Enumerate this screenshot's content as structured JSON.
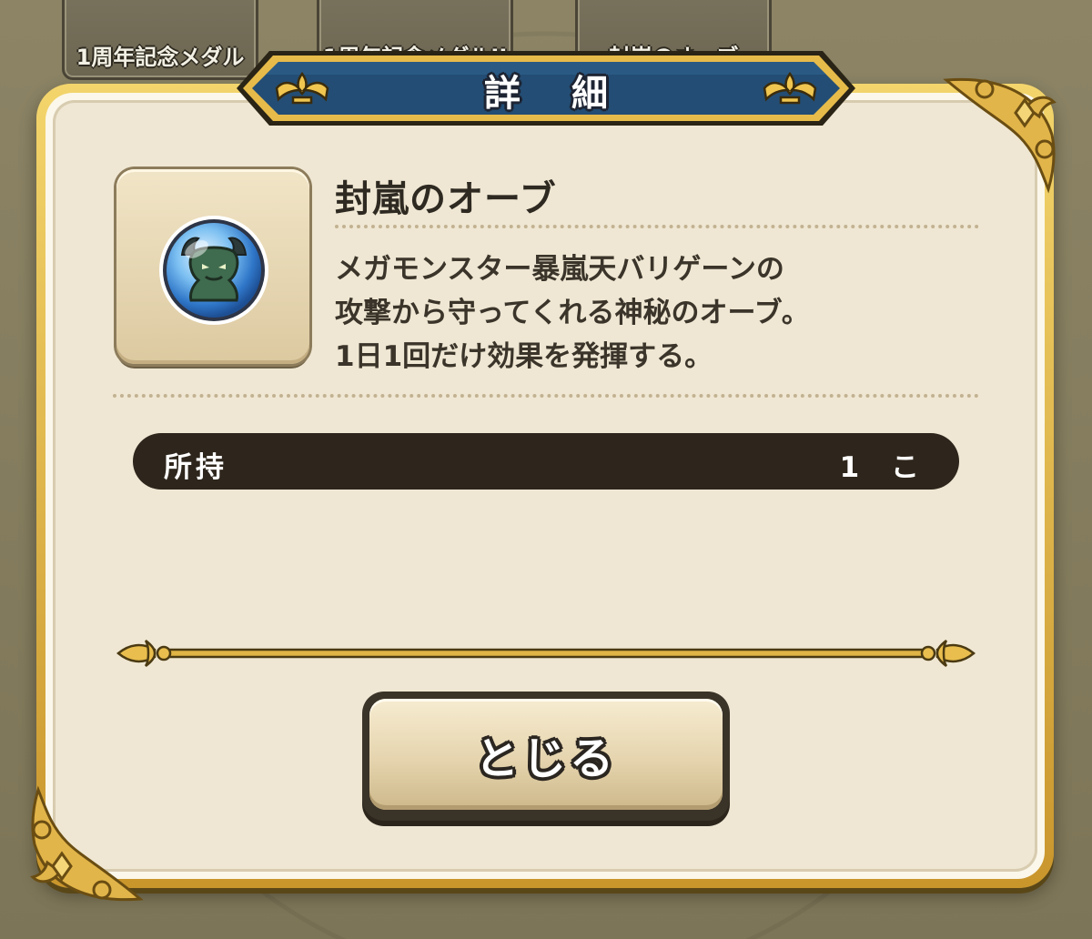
{
  "background_tiles": [
    {
      "label": "1周年記念メダル"
    },
    {
      "label": "1周年記念メダルII"
    },
    {
      "label": "封嵐のオーブ"
    }
  ],
  "dialog": {
    "title": "詳細",
    "item": {
      "name": "封嵐のオーブ",
      "icon": "demon-orb-icon",
      "description_lines": [
        "メガモンスター暴嵐天バリゲーンの",
        "攻撃から守ってくれる神秘のオーブ。",
        "1日1回だけ効果を発揮する。"
      ]
    },
    "owned": {
      "label": "所持",
      "count": "1 こ"
    },
    "close_button": {
      "label": "とじる"
    }
  },
  "colors": {
    "gold_frame": "#d9a93a",
    "banner_blue": "#1f4a72",
    "panel": "#efe7d3",
    "dark_bar": "#2e261c",
    "orb_blue": "#3a8fd8"
  }
}
